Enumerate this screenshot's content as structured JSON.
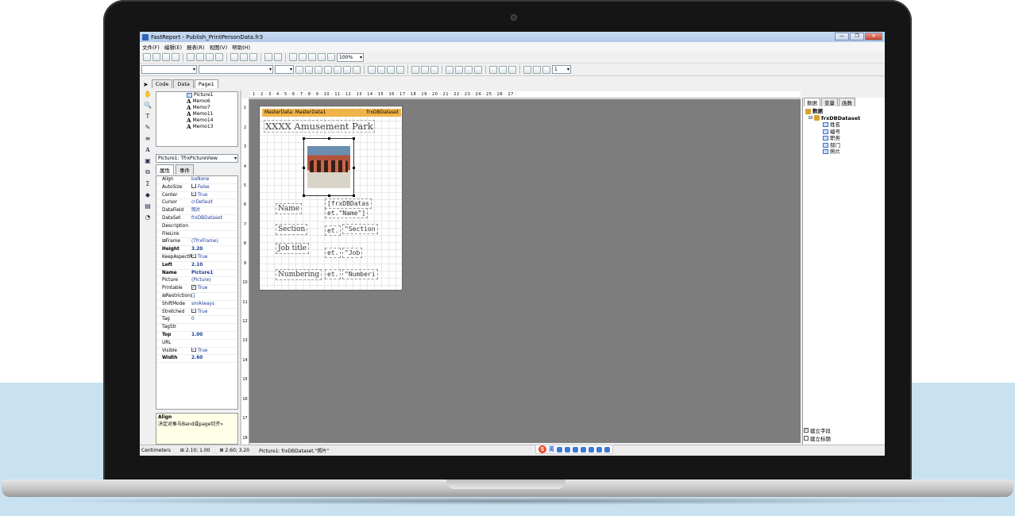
{
  "window": {
    "title": "FastReport - Publish_PrintPersonData.fr3"
  },
  "menu": [
    "文件(F)",
    "编辑(E)",
    "报表(R)",
    "视图(V)",
    "帮助(H)"
  ],
  "toolbar": {
    "zoom": "100%",
    "frame_width": "1"
  },
  "tabs": [
    "Code",
    "Data",
    "Page1"
  ],
  "tree": [
    {
      "icon": "picture",
      "label": "Picture1"
    },
    {
      "icon": "text",
      "label": "Memo6"
    },
    {
      "icon": "text",
      "label": "Memo7"
    },
    {
      "icon": "text",
      "label": "Memo11"
    },
    {
      "icon": "text",
      "label": "Memo14"
    },
    {
      "icon": "text",
      "label": "Memo13"
    }
  ],
  "object_selector": "Picture1: TfrxPictureView",
  "prop_tabs": [
    "属性",
    "事件"
  ],
  "properties": [
    {
      "name": "Align",
      "value": "baNone",
      "bold": false
    },
    {
      "name": "AutoSize",
      "value": "False",
      "check": false
    },
    {
      "name": "Center",
      "value": "True",
      "check": true
    },
    {
      "name": "Cursor",
      "value": "crDefault"
    },
    {
      "name": "DataField",
      "value": "照片"
    },
    {
      "name": "DataSet",
      "value": "frxDBDataset"
    },
    {
      "name": "Description",
      "value": ""
    },
    {
      "name": "FileLink",
      "value": ""
    },
    {
      "name": "⊞Frame",
      "value": "(TfrxFrame)"
    },
    {
      "name": "Height",
      "value": "3.20",
      "bold": true
    },
    {
      "name": "KeepAspectR",
      "value": "True",
      "check": true
    },
    {
      "name": "Left",
      "value": "2.10",
      "bold": true
    },
    {
      "name": "Name",
      "value": "Picture1",
      "bold": true
    },
    {
      "name": "Picture",
      "value": "(Picture)"
    },
    {
      "name": "Printable",
      "value": "True",
      "check": true
    },
    {
      "name": "⊞Restrictions",
      "value": "[]"
    },
    {
      "name": "ShiftMode",
      "value": "smAlways"
    },
    {
      "name": "Stretched",
      "value": "True",
      "check": true
    },
    {
      "name": "Tag",
      "value": "0"
    },
    {
      "name": "TagStr",
      "value": ""
    },
    {
      "name": "Top",
      "value": "1.00",
      "bold": true
    },
    {
      "name": "URL",
      "value": ""
    },
    {
      "name": "Visible",
      "value": "True",
      "check": true
    },
    {
      "name": "Width",
      "value": "2.60",
      "bold": true
    }
  ],
  "help": {
    "title": "Align",
    "text": "决定对象与Band或page切齐»"
  },
  "ruler_marks": "· 1 · 2 · 3 · 4 · 5 · 6 · 7 · 8 · 9 · 10 · 11 · 12 · 13 · 14 · 15 · 16 · 17 · 18 · 19 · 20 · 21 · 22 · 23 · 24 · 25 · 26 · 27 ·",
  "band": {
    "left": "MasterData: MasterData1",
    "right": "frxDBDataset"
  },
  "report": {
    "title": "XXXX Amusement Park",
    "fields": [
      {
        "label": "Name",
        "value_a": "[frxDBDatas",
        "value_b": "et.\"Name\"]"
      },
      {
        "label": "Section",
        "value_a": "et.",
        "value_b": "\"Section"
      },
      {
        "label": "Job title",
        "value_a": "et.",
        "value_b": "\"Job"
      },
      {
        "label": "Numbering",
        "value_a": "et.",
        "value_b": "\"Numberi"
      }
    ]
  },
  "right_panel": {
    "tabs": [
      "数据",
      "变量",
      "函数"
    ],
    "root": "数据",
    "dataset": "frxDBDataset",
    "fields": [
      "姓名",
      "编号",
      "职务",
      "部门",
      "照片"
    ],
    "checks": [
      {
        "label": "建立字段",
        "checked": true
      },
      {
        "label": "建立标题",
        "checked": false
      }
    ]
  },
  "status": {
    "units": "Centimeters",
    "pos": "2.10; 1.00",
    "size": "2.60; 3.20",
    "info": "Picture1: frxDBDataset.\"照片\""
  },
  "ime": {
    "label": "英"
  }
}
